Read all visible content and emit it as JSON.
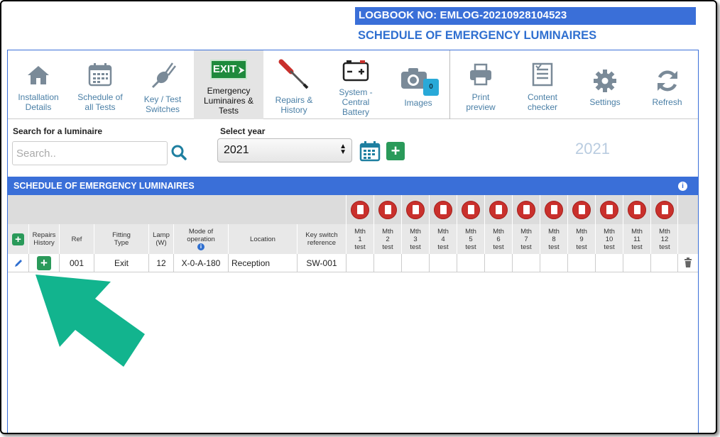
{
  "header": {
    "logbook": "LOGBOOK NO: EMLOG-20210928104523",
    "title": "SCHEDULE OF EMERGENCY LUMINAIRES"
  },
  "toolbar": [
    {
      "label": [
        "Installation",
        "Details"
      ],
      "icon": "home-icon"
    },
    {
      "label": [
        "Schedule of",
        "all Tests"
      ],
      "icon": "calendar-icon"
    },
    {
      "label": [
        "Key / Test",
        "Switches"
      ],
      "icon": "key-switch-icon"
    },
    {
      "label": [
        "Emergency",
        "Luminaires &",
        "Tests"
      ],
      "icon": "exit-sign-icon",
      "active": true
    },
    {
      "label": [
        "Repairs &",
        "History"
      ],
      "icon": "screwdriver-icon"
    },
    {
      "label": [
        "System -",
        "Central",
        "Battery"
      ],
      "icon": "battery-icon"
    },
    {
      "label": [
        "Images"
      ],
      "icon": "camera-icon",
      "badge": "0"
    },
    {
      "label": [
        "Print",
        "preview"
      ],
      "icon": "printer-icon"
    },
    {
      "label": [
        "Content",
        "checker"
      ],
      "icon": "checklist-icon"
    },
    {
      "label": [
        "Settings"
      ],
      "icon": "gear-icon"
    },
    {
      "label": [
        "Refresh"
      ],
      "icon": "refresh-icon"
    }
  ],
  "exit_sign_text": "EXIT",
  "search": {
    "label": "Search for a luminaire",
    "placeholder": "Search.."
  },
  "year": {
    "label": "Select year",
    "value": "2021",
    "display": "2021"
  },
  "section_title": "SCHEDULE OF EMERGENCY LUMINAIRES",
  "table": {
    "headers": {
      "repairs": [
        "Repairs",
        "History"
      ],
      "ref": "Ref",
      "fitting": [
        "Fitting",
        "Type"
      ],
      "lamp": [
        "Lamp",
        "(W)"
      ],
      "mode": [
        "Mode of",
        "operation"
      ],
      "location": "Location",
      "key": [
        "Key switch",
        "reference"
      ],
      "months": [
        "1",
        "2",
        "3",
        "4",
        "5",
        "6",
        "7",
        "8",
        "9",
        "10",
        "11",
        "12"
      ],
      "month_prefix": "Mth",
      "month_suffix": "test"
    },
    "rows": [
      {
        "ref": "001",
        "fitting": "Exit",
        "lamp": "12",
        "mode": "X-0-A-180",
        "location": "Reception",
        "key": "SW-001"
      }
    ]
  },
  "colors": {
    "accent": "#3a6fd8",
    "green": "#2a9a5a",
    "arrow": "#12b48e",
    "pdf_red": "#c9302c"
  }
}
